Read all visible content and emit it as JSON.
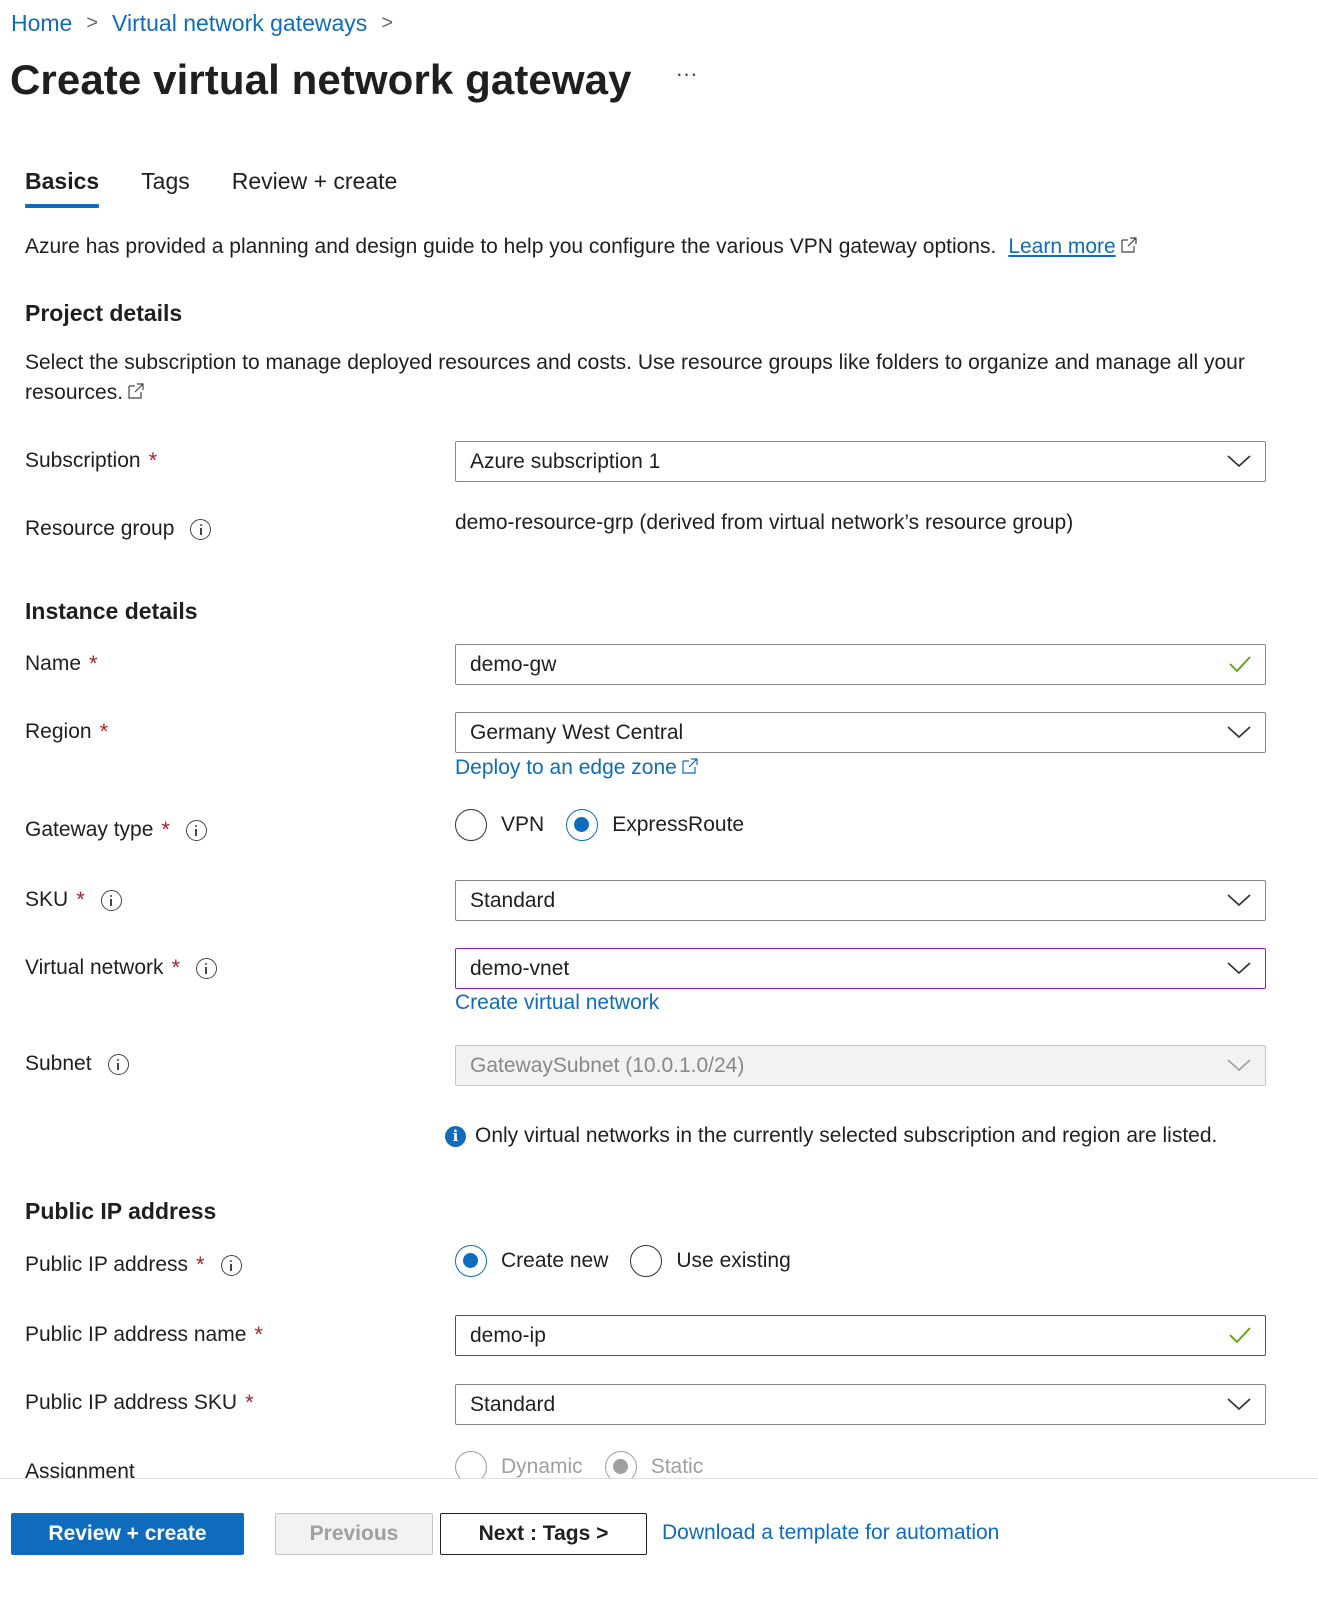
{
  "breadcrumb": [
    {
      "label": "Home"
    },
    {
      "label": "Virtual network gateways"
    }
  ],
  "page": {
    "title": "Create virtual network gateway",
    "more_label": "···"
  },
  "tabs": [
    {
      "label": "Basics",
      "active": true
    },
    {
      "label": "Tags",
      "active": false
    },
    {
      "label": "Review + create",
      "active": false
    }
  ],
  "intro": {
    "text": "Azure has provided a planning and design guide to help you configure the various VPN gateway options.",
    "link": "Learn more"
  },
  "project_details": {
    "title": "Project details",
    "description": "Select the subscription to manage deployed resources and costs. Use resource groups like folders to organize and manage all your resources.",
    "subscription": {
      "label": "Subscription",
      "value": "Azure subscription 1",
      "required": true
    },
    "resource_group": {
      "label": "Resource group",
      "value": "demo-resource-grp (derived from virtual network’s resource group)"
    }
  },
  "instance_details": {
    "title": "Instance details",
    "name": {
      "label": "Name",
      "value": "demo-gw",
      "valid": true
    },
    "region": {
      "label": "Region",
      "value": "Germany West Central",
      "link": "Deploy to an edge zone"
    },
    "gateway_type": {
      "label": "Gateway type",
      "options": [
        "VPN",
        "ExpressRoute"
      ],
      "selected": "ExpressRoute"
    },
    "sku": {
      "label": "SKU",
      "value": "Standard"
    },
    "virtual_network": {
      "label": "Virtual network",
      "value": "demo-vnet",
      "link": "Create virtual network"
    },
    "subnet": {
      "label": "Subnet",
      "value": "GatewaySubnet (10.0.1.0/24)",
      "disabled": true
    },
    "note": "Only virtual networks in the currently selected subscription and region are listed."
  },
  "public_ip": {
    "title": "Public IP address",
    "address": {
      "label": "Public IP address",
      "options": [
        "Create new",
        "Use existing"
      ],
      "selected": "Create new"
    },
    "name": {
      "label": "Public IP address name",
      "value": "demo-ip",
      "valid": true
    },
    "sku": {
      "label": "Public IP address SKU",
      "value": "Standard"
    },
    "assignment": {
      "label": "Assignment",
      "options": [
        "Dynamic",
        "Static"
      ],
      "selected": "Static",
      "disabled": true
    }
  },
  "footer": {
    "review_create": "Review + create",
    "previous": "Previous",
    "next": "Next : Tags >",
    "download_link": "Download a template for automation"
  },
  "colors": {
    "accent": "#0f6cbd",
    "required": "#a4262c",
    "focus_border": "#8a1fbf",
    "valid_check": "#57a300"
  }
}
